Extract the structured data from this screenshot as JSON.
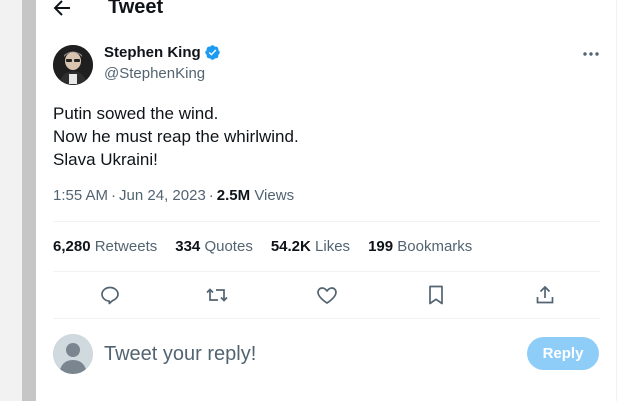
{
  "colors": {
    "accent": "#1d9bf0",
    "reply_button_disabled": "#8ecdf8",
    "text_primary": "#0f1419",
    "text_secondary": "#536471",
    "divider": "#eff3f4"
  },
  "header": {
    "title": "Tweet",
    "back_icon": "arrow-left-icon"
  },
  "tweet": {
    "author": {
      "display_name": "Stephen King",
      "handle": "@StephenKing",
      "verified": true,
      "avatar_icon": "profile-photo"
    },
    "text_lines": [
      "Putin sowed the wind.",
      "Now he must reap the whirlwind.",
      "Slava Ukraini!"
    ],
    "time": "1:55 AM",
    "date": "Jun 24, 2023",
    "separator": "·",
    "views_count": "2.5M",
    "views_label": "Views",
    "stats": {
      "retweets_count": "6,280",
      "retweets_label": "Retweets",
      "quotes_count": "334",
      "quotes_label": "Quotes",
      "likes_count": "54.2K",
      "likes_label": "Likes",
      "bookmarks_count": "199",
      "bookmarks_label": "Bookmarks"
    },
    "actions": [
      "reply-icon",
      "retweet-icon",
      "like-icon",
      "bookmark-icon",
      "share-icon"
    ]
  },
  "reply_box": {
    "placeholder": "Tweet your reply!",
    "button_label": "Reply"
  }
}
